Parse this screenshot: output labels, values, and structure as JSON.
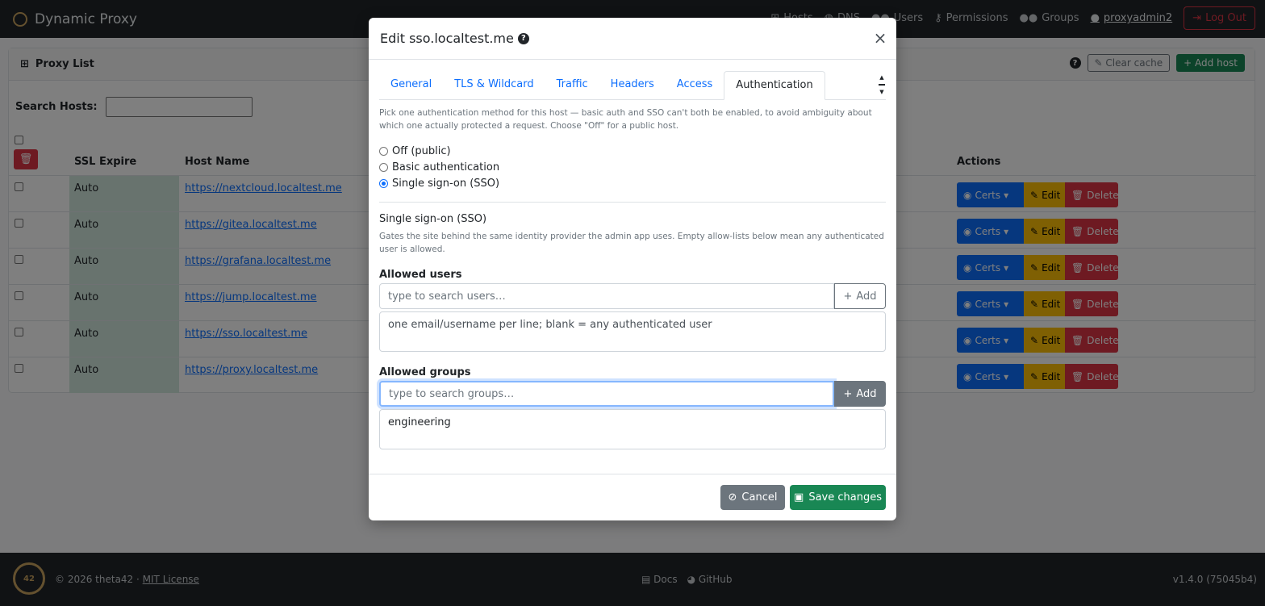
{
  "app": {
    "title": "Dynamic Proxy"
  },
  "nav": {
    "items": [
      {
        "label": "Hosts",
        "icon": "sitemap-icon"
      },
      {
        "label": "DNS",
        "icon": "globe-icon"
      },
      {
        "label": "Users",
        "icon": "users-icon"
      },
      {
        "label": "Permissions",
        "icon": "key-icon"
      },
      {
        "label": "Groups",
        "icon": "groups-icon"
      }
    ],
    "user": "proxyadmin2",
    "logout": "Log Out"
  },
  "proxy_list": {
    "title": "Proxy List",
    "clear_cache": "Clear cache",
    "add_host": "Add host",
    "search_label": "Search Hosts:",
    "columns": {
      "ssl": "SSL Expire",
      "host": "Host Name",
      "actions": "Actions"
    },
    "rows": [
      {
        "ssl": "Auto",
        "host": "https://nextcloud.localtest.me"
      },
      {
        "ssl": "Auto",
        "host": "https://gitea.localtest.me"
      },
      {
        "ssl": "Auto",
        "host": "https://grafana.localtest.me"
      },
      {
        "ssl": "Auto",
        "host": "https://jump.localtest.me"
      },
      {
        "ssl": "Auto",
        "host": "https://sso.localtest.me"
      },
      {
        "ssl": "Auto",
        "host": "https://proxy.localtest.me"
      }
    ],
    "row_actions": {
      "certs": "Certs",
      "edit": "Edit",
      "delete": "Delete"
    }
  },
  "footer": {
    "logo_text": "42",
    "copyright": "© 2026 theta42 ·",
    "license": "MIT License",
    "docs": "Docs",
    "github": "GitHub",
    "version": "v1.4.0 (75045b4)"
  },
  "modal": {
    "title": "Edit sso.localtest.me",
    "tabs": [
      "General",
      "TLS & Wildcard",
      "Traffic",
      "Headers",
      "Access",
      "Authentication"
    ],
    "active_tab": "Authentication",
    "intro": "Pick one authentication method for this host — basic auth and SSO can't both be enabled, to avoid ambiguity about which one actually protected a request. Choose \"Off\" for a public host.",
    "auth_options": [
      {
        "label": "Off (public)",
        "checked": false
      },
      {
        "label": "Basic authentication",
        "checked": false
      },
      {
        "label": "Single sign-on (SSO)",
        "checked": true
      }
    ],
    "sso_title": "Single sign-on (SSO)",
    "sso_help": "Gates the site behind the same identity provider the admin app uses. Empty allow-lists below mean any authenticated user is allowed.",
    "allowed_users": {
      "label": "Allowed users",
      "search_placeholder": "type to search users…",
      "add": "Add",
      "textarea_placeholder": "one email/username per line; blank = any authenticated user"
    },
    "allowed_groups": {
      "label": "Allowed groups",
      "search_placeholder": "type to search groups…",
      "add": "Add",
      "value": "engineering"
    },
    "cancel": "Cancel",
    "save": "Save changes"
  },
  "colors": {
    "primary": "#0d6efd",
    "success": "#198754",
    "warning": "#ffc107",
    "danger": "#dc3545",
    "secondary": "#6c757d",
    "navbar": "#212529",
    "ssl_cell": "#d1e7dd"
  }
}
